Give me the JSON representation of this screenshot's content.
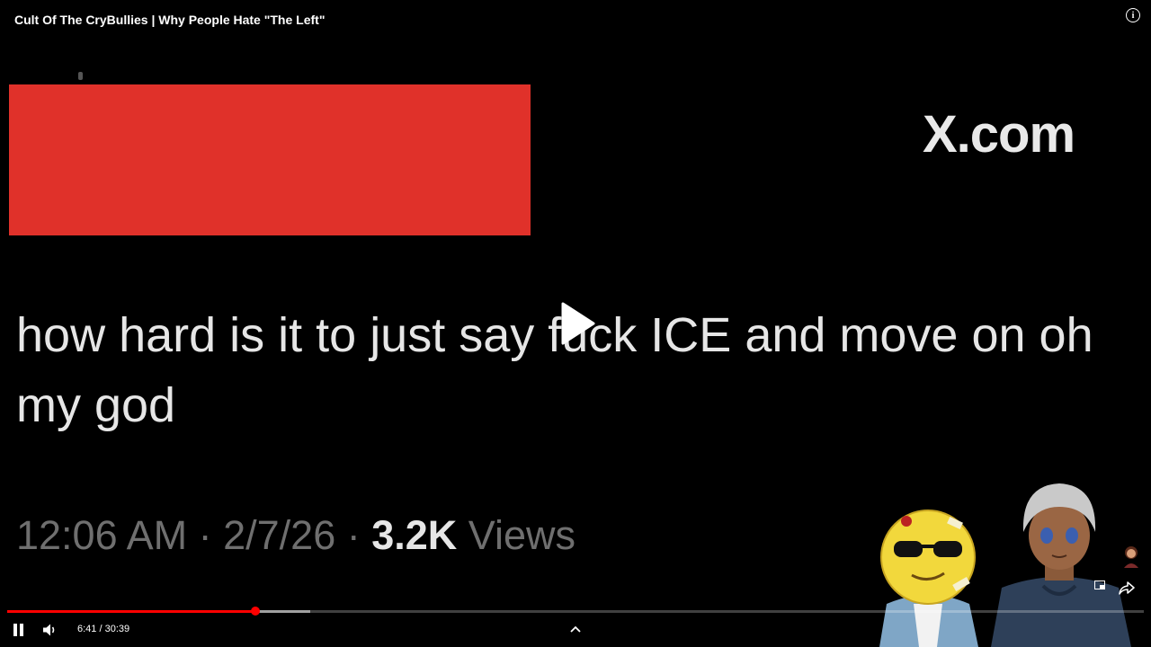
{
  "player": {
    "title": "Cult Of The CryBullies | Why People Hate \"The Left\"",
    "info_icon": "info-icon",
    "current_time": "6:41",
    "separator": "/",
    "duration": "30:39",
    "time_display": "6:41 / 30:39",
    "progress_fraction": 0.218,
    "buffered_fraction": 0.267,
    "accent_color": "#ff0000"
  },
  "video_frame": {
    "site_logo": "X.com",
    "redaction_color": "#e0312a",
    "tweet_text": "how hard is it to just say fuck ICE and move on oh my god",
    "tweet_time": "12:06 AM · 2/7/26 · ",
    "tweet_views_count": "3.2K",
    "tweet_views_label": " Views"
  },
  "controls": {
    "pause_icon": "pause-icon",
    "volume_icon": "volume-icon",
    "play_icon": "play-icon",
    "chevron_icon": "chevron-up-icon",
    "share_icon": "share-icon"
  }
}
